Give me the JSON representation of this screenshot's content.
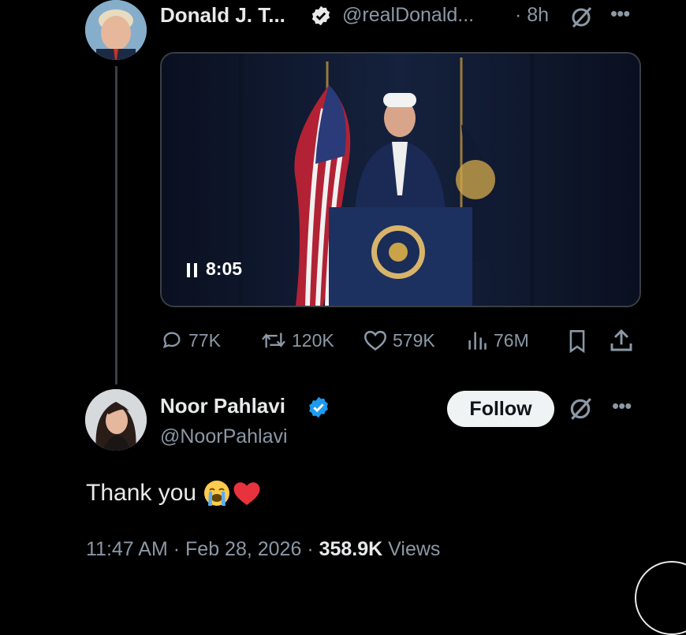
{
  "parent_tweet": {
    "author_name": "Donald J. T...",
    "handle": "@realDonald...",
    "time": "· 8h",
    "video": {
      "duration": "8:05"
    },
    "actions": {
      "replies": "77K",
      "reposts": "120K",
      "likes": "579K",
      "views": "76M"
    }
  },
  "reply_tweet": {
    "author_name": "Noor Pahlavi",
    "handle": "@NoorPahlavi",
    "follow_label": "Follow",
    "text": "Thank you",
    "emojis": [
      "loudly-crying-face",
      "red-heart"
    ],
    "time": "11:47 AM",
    "date": "Feb 28, 2026",
    "views_count": "358.9K",
    "views_label": "Views",
    "separator": "·"
  },
  "colors": {
    "background": "#000000",
    "text_primary": "#e7e9ea",
    "text_secondary": "#8b98a5",
    "verified_blue": "#1d9bf0",
    "follow_button_bg": "#eff3f4"
  }
}
